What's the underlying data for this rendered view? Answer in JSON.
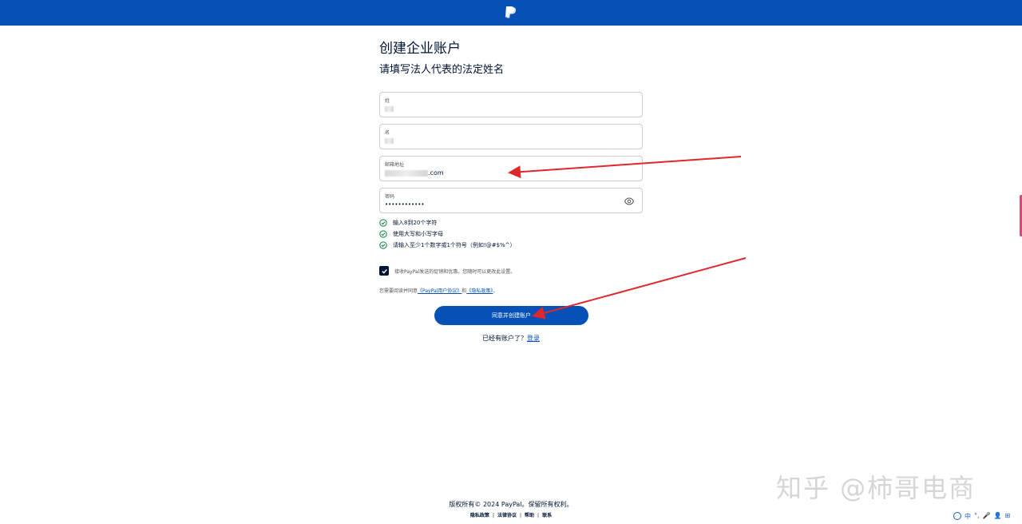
{
  "header": {
    "logo_icon": "paypal-logo-icon"
  },
  "page": {
    "title": "创建企业账户",
    "subtitle": "请填写法人代表的法定姓名"
  },
  "form": {
    "last_name": {
      "label": "姓",
      "value": ""
    },
    "first_name": {
      "label": "名",
      "value": ""
    },
    "email": {
      "label": "邮箱地址",
      "value_suffix": ".com"
    },
    "password": {
      "label": "密码",
      "value": "••••••••••••"
    }
  },
  "password_rules": [
    {
      "text": "输入8到20个字符"
    },
    {
      "text": "使用大写和小写字母"
    },
    {
      "text": "请输入至少1个数字或1个符号（例如!@#$%^）"
    }
  ],
  "consent": {
    "text": "接收PayPal发送的促销和优惠。您随时可以更改此设置。",
    "checked": true
  },
  "agreement": {
    "prefix": "您需要阅读并同意",
    "link1": "《PayPal用户协议》",
    "middle": "和",
    "link2": "《隐私政策》",
    "suffix": "。"
  },
  "primary_button": {
    "label": "同意并创建账户"
  },
  "login": {
    "prefix": "已经有账户了？",
    "link": "登录"
  },
  "footer": {
    "copyright": "版权所有© 2024 PayPal。保留所有权利。",
    "links": [
      "隐私政策",
      "法律协议",
      "帮助",
      "联系"
    ]
  },
  "watermark": {
    "text": "知乎 @柿哥电商"
  },
  "tray": {
    "items": [
      "中",
      "°,",
      "🎤",
      "👤",
      "⊞"
    ]
  },
  "colors": {
    "brand": "#0551b5",
    "text": "#001435",
    "success": "#0b8043",
    "annotation": "#e0282c"
  }
}
